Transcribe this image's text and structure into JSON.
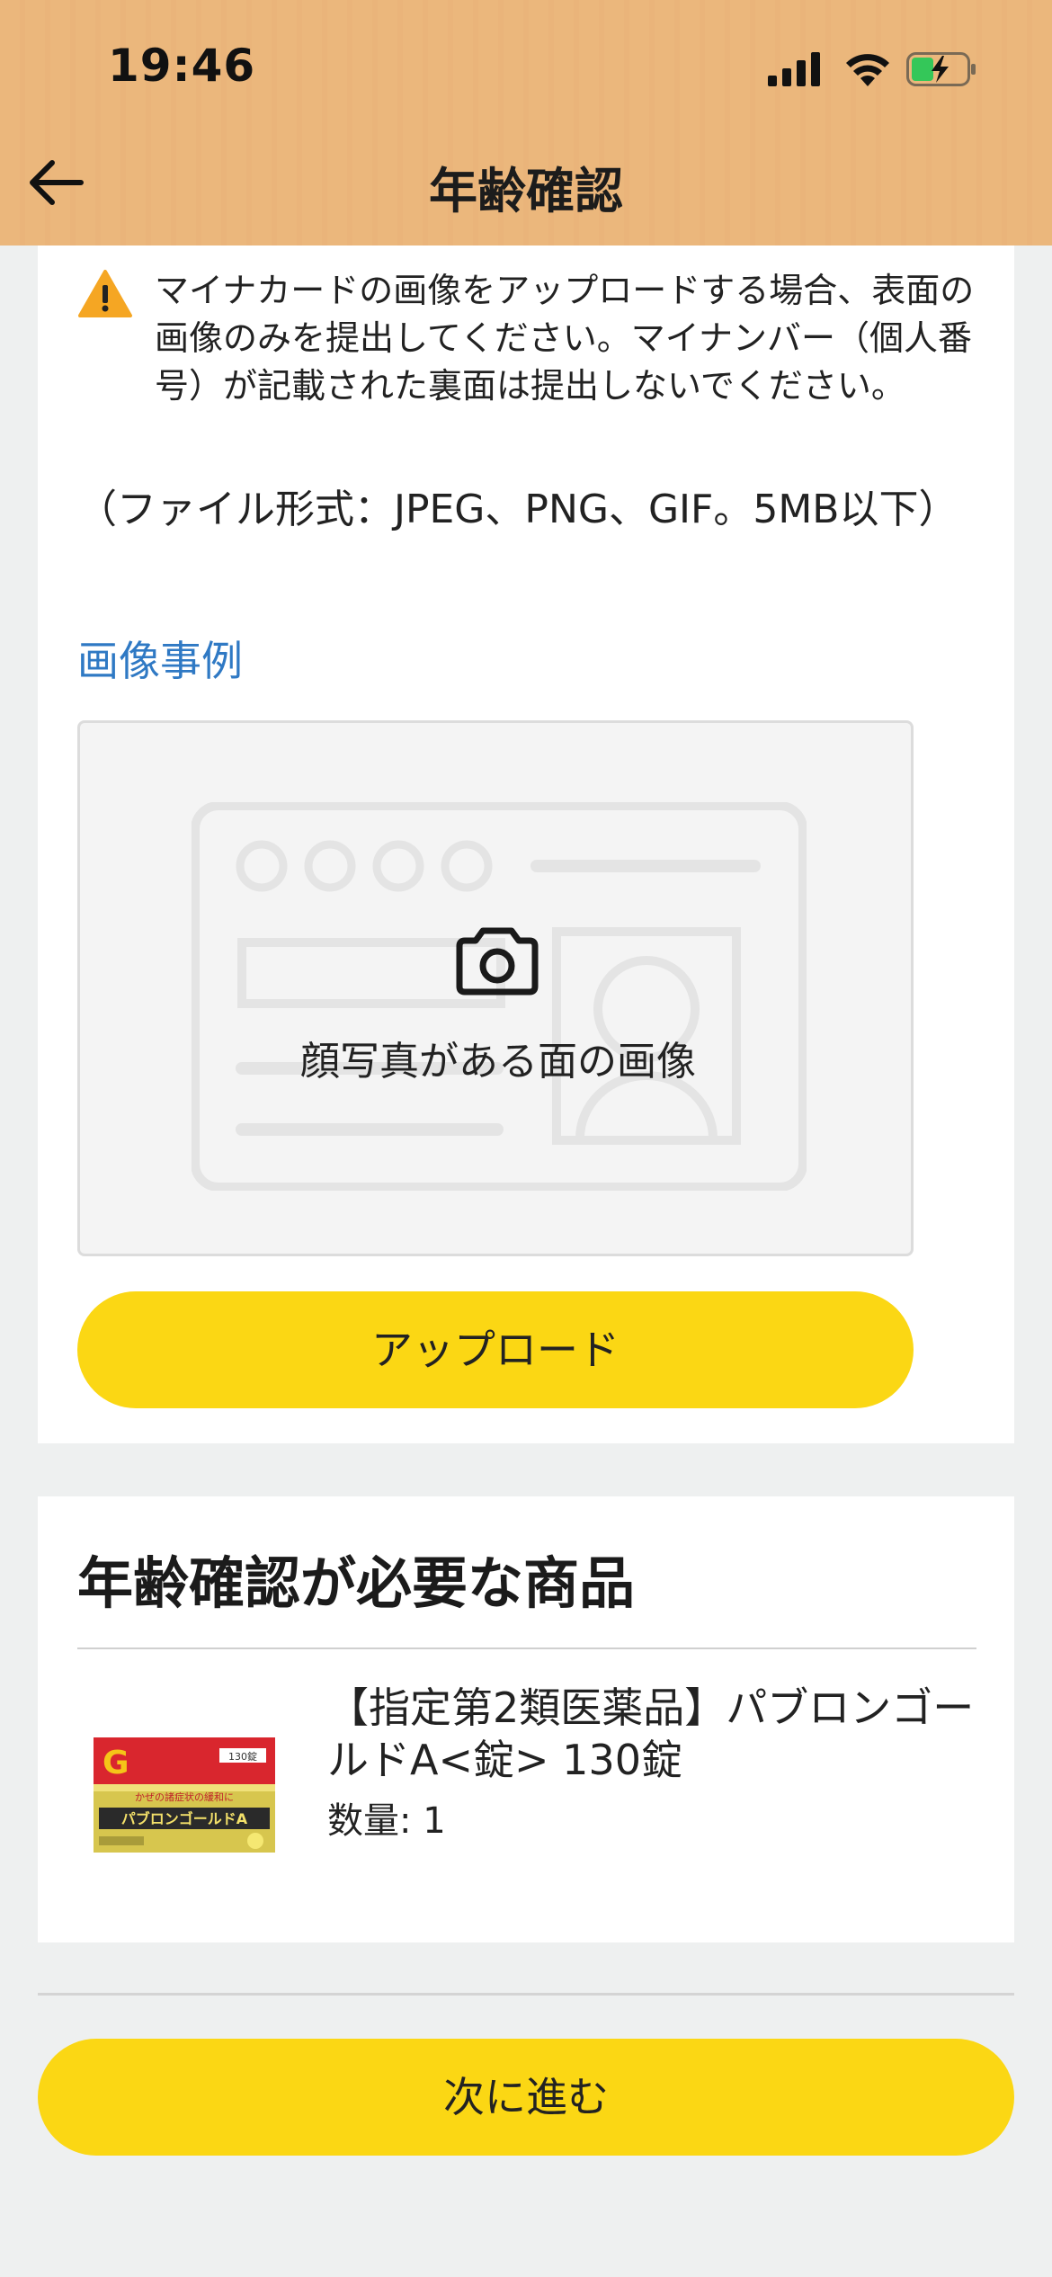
{
  "status_bar": {
    "time": "19:46"
  },
  "header": {
    "title": "年齢確認"
  },
  "upload_section": {
    "warning": "マイナカードの画像をアップロードする場合、表面の画像のみを提出してください。マイナンバー（個人番号）が記載された裏面は提出しないでください。",
    "file_format": "（ファイル形式：JPEG、PNG、GIF。5MB以下）",
    "example_link": "画像事例",
    "area_label": "顔写真がある面の画像",
    "upload_button": "アップロード"
  },
  "products_section": {
    "title": "年齢確認が必要な商品",
    "items": [
      {
        "name": "【指定第2類医薬品】パブロンゴールドA<錠> 130錠",
        "quantity": "数量: 1"
      }
    ],
    "package": {
      "badge": "130錠",
      "tagline": "かぜの諸症状の緩和に",
      "brand": "パブロンゴールドA"
    }
  },
  "footer": {
    "next_button": "次に進む"
  },
  "colors": {
    "header_bg": "#ebb77c",
    "accent_yellow": "#fbd714",
    "link_blue": "#2f79c4",
    "warning_orange": "#f5a623"
  }
}
